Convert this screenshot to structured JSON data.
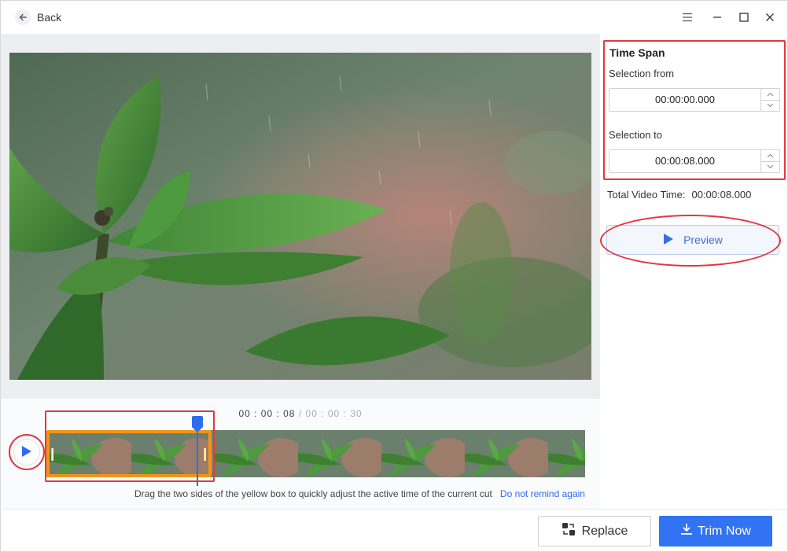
{
  "titlebar": {
    "back_label": "Back",
    "icons": [
      "arrow-left-icon",
      "menu-icon",
      "minimize-icon",
      "maximize-icon",
      "close-icon"
    ]
  },
  "time_span": {
    "title": "Time Span",
    "from_label": "Selection from",
    "from_value": "00:00:00.000",
    "to_label": "Selection to",
    "to_value": "00:00:08.000",
    "total_label": "Total Video Time:",
    "total_value": "00:00:08.000"
  },
  "preview": {
    "label": "Preview",
    "icon": "play-icon"
  },
  "timeline": {
    "current": "00 : 00 : 08",
    "separator": "/",
    "total": "00 : 00 : 30",
    "hint": "Drag the two sides of the yellow box to quickly adjust the active time of the current cut",
    "dismiss_link": "Do not remind again",
    "play_icon": "play-icon"
  },
  "footer": {
    "replace_label": "Replace",
    "replace_icon": "replace-icon",
    "trim_label": "Trim Now",
    "trim_icon": "download-icon"
  },
  "colors": {
    "accent": "#3173f3",
    "highlight": "#e0393e",
    "selection": "#f39416"
  }
}
